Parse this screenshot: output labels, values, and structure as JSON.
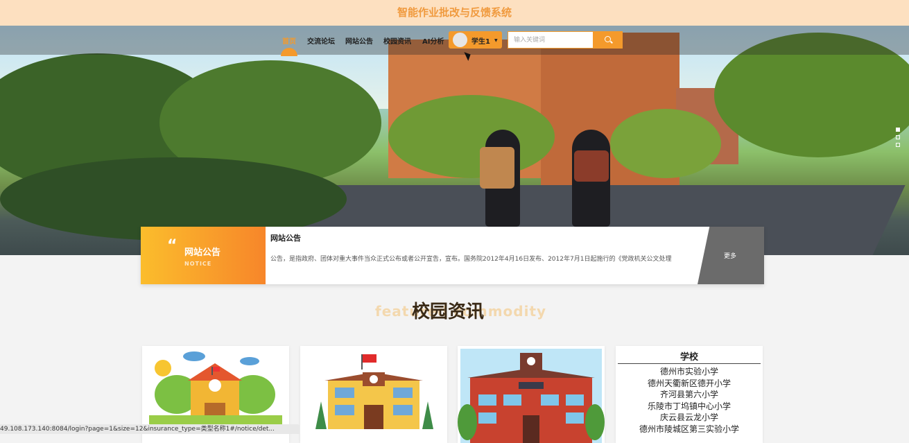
{
  "header": {
    "title": "智能作业批改与反馈系统"
  },
  "nav": {
    "items": [
      {
        "label": "首页",
        "active": true
      },
      {
        "label": "交流论坛"
      },
      {
        "label": "网站公告"
      },
      {
        "label": "校园资讯"
      },
      {
        "label": "AI分析"
      }
    ],
    "user": {
      "name": "学生1"
    },
    "search": {
      "placeholder": "输入关键词"
    }
  },
  "notice": {
    "label": "网站公告",
    "label_sub": "NOTICE",
    "title": "网站公告",
    "text": "公告，是指政府、团体对重大事件当众正式公布或者公开宣告，宣布。国务院2012年4月16日发布、2012年7月1日起施行的《党政机关公文处理",
    "more": "更多"
  },
  "section": {
    "title": "校园资讯",
    "subtitle": "featured commodity"
  },
  "school_card": {
    "heading": "学校",
    "lines": [
      "德州市实验小学",
      "德州天衢新区德开小学",
      "齐河县第六小学",
      "乐陵市丁坞镇中心小学",
      "庆云县云龙小学",
      "德州市陵城区第三实验小学"
    ]
  },
  "status_url": "49.108.173.140:8084/login?page=1&size=12&insurance_type=类型名称1#/notice/det...",
  "colors": {
    "accent": "#f49a2c",
    "header_bg": "#fde0c0"
  }
}
